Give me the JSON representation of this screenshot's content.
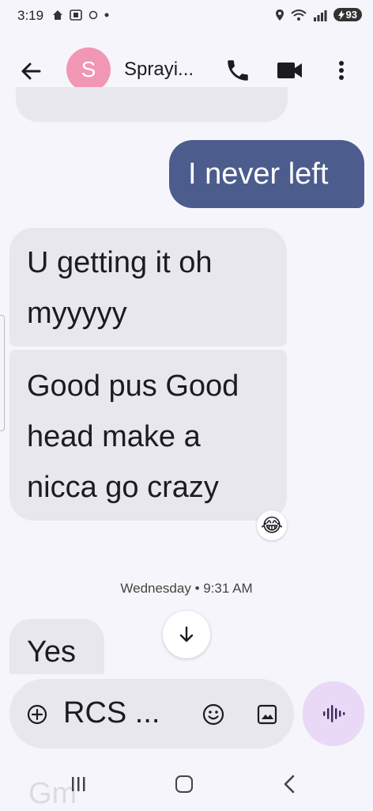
{
  "status_bar": {
    "time": "3:19",
    "battery": "93"
  },
  "header": {
    "avatar_letter": "S",
    "contact_name": "Sprayi..."
  },
  "messages": {
    "outgoing_1": "I never left",
    "incoming_1": "U getting it oh myyyyy",
    "incoming_2": "Good pus Good head make a nicca go crazy",
    "reaction": "😂",
    "timestamp": "Wednesday • 9:31 AM",
    "incoming_3": "Yes",
    "ghost": "Gm"
  },
  "composer": {
    "placeholder": "RCS ..."
  },
  "colors": {
    "outgoing_bubble": "#4c5c8c",
    "incoming_bubble": "#e8e7ed",
    "avatar": "#f196b4",
    "voice_button": "#e9d8f6"
  }
}
